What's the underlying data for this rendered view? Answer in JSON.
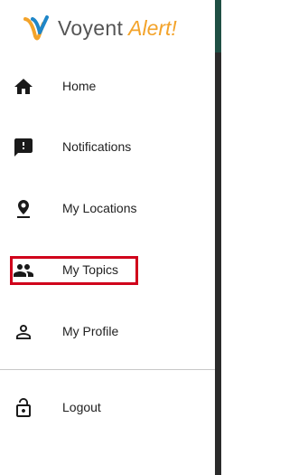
{
  "brand": {
    "name": "Voyent",
    "accent": "Alert!",
    "color_primary": "#555555",
    "color_accent": "#f3a32a",
    "mark_colors": [
      "#f3a32a",
      "#1f86c8"
    ]
  },
  "menu": {
    "items": [
      {
        "label": "Home",
        "icon": "home-icon"
      },
      {
        "label": "Notifications",
        "icon": "notification-alert-icon"
      },
      {
        "label": "My Locations",
        "icon": "location-pin-icon"
      },
      {
        "label": "My Topics",
        "icon": "people-icon",
        "highlighted": true
      },
      {
        "label": "My Profile",
        "icon": "person-icon"
      }
    ],
    "footer_items": [
      {
        "label": "Logout",
        "icon": "unlock-icon"
      }
    ]
  },
  "highlight_color": "#d0021b",
  "backdrop_color": "#2b2b2b"
}
